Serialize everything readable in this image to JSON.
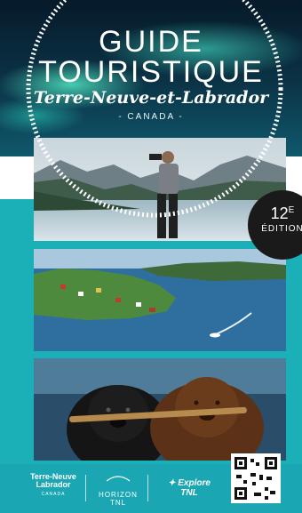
{
  "cover": {
    "title_line1": "GUIDE",
    "title_line2": "TOURISTIQUE",
    "subtitle": "Terre-Neuve-et-Labrador",
    "country": "- CANADA -"
  },
  "badge": {
    "number": "12",
    "suffix": "E",
    "label": "ÉDITION"
  },
  "footer": {
    "logo1_line1": "Terre-Neuve",
    "logo1_line2": "Labrador",
    "logo1_tag": "CANADA",
    "logo2_name": "HORIZON",
    "logo2_sub": "TNL",
    "logo3_name": "Explore TNL"
  },
  "colors": {
    "teal": "#1bb0b8",
    "aurora": "#5affd2",
    "badge": "#1a1a1a"
  }
}
